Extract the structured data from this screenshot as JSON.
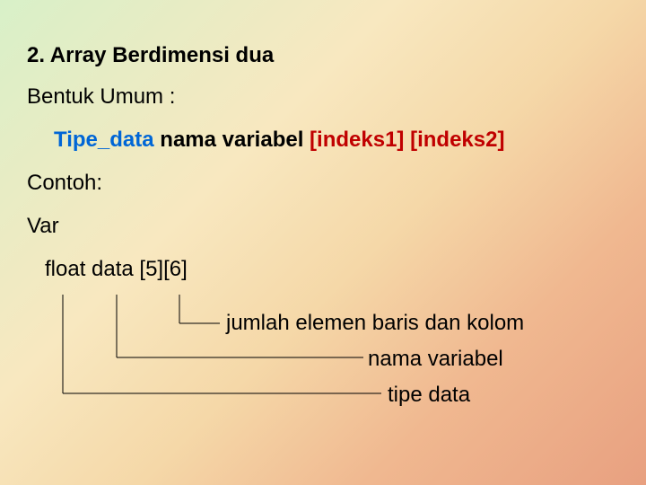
{
  "title": "2.  Array Berdimensi dua",
  "bentuk_umum": "Bentuk Umum :",
  "syntax": {
    "tipe": "Tipe_data",
    "nama": " nama variabel ",
    "idx1": "[indeks1]",
    "space": " ",
    "idx2": "[indeks2]"
  },
  "contoh": "Contoh:",
  "var": "Var",
  "decl": "float data [5][6]",
  "annotations": {
    "a1": "jumlah elemen baris dan kolom",
    "a2": "nama variabel",
    "a3": "tipe data"
  }
}
